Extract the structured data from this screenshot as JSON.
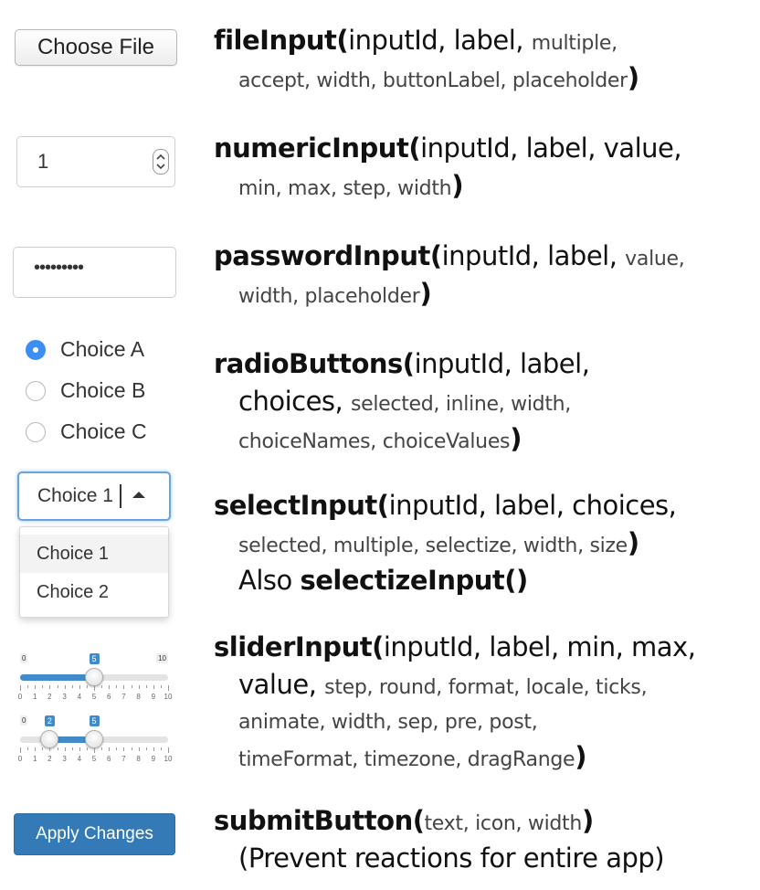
{
  "widgets": {
    "file_button_label": "Choose File",
    "numeric_value": "1",
    "password_mask": "•••••••••",
    "radio": [
      {
        "label": "Choice A",
        "selected": true
      },
      {
        "label": "Choice B",
        "selected": false
      },
      {
        "label": "Choice C",
        "selected": false
      }
    ],
    "select": {
      "value": "Choice 1",
      "options": [
        "Choice 1",
        "Choice 2"
      ],
      "highlighted": "Choice 1"
    },
    "slider_single": {
      "min": "0",
      "max": "10",
      "value": "5",
      "value_fraction": 0.5
    },
    "slider_range": {
      "min": "0",
      "max": "10",
      "from": "2",
      "to": "5",
      "from_fraction": 0.2,
      "to_fraction": 0.5
    },
    "slider_ticks": [
      "0",
      "1",
      "2",
      "3",
      "4",
      "5",
      "6",
      "7",
      "8",
      "9",
      "10"
    ],
    "apply_button_label": "Apply Changes",
    "accent_color": "#428bca"
  },
  "signatures": {
    "fileInput": {
      "name": "fileInput(",
      "line1_args": "inputId, label, ",
      "line1_opt": "multiple,",
      "line2_opt": "accept, width, buttonLabel, placeholder",
      "close": ")"
    },
    "numericInput": {
      "name": "numericInput(",
      "line1_args": "inputId, label, value,",
      "line2_opt": "min, max, step, width",
      "close": ")"
    },
    "passwordInput": {
      "name": "passwordInput(",
      "line1_args": "inputId, label, ",
      "line1_opt": "value,",
      "line2_opt": "width, placeholder",
      "close": ")"
    },
    "radioButtons": {
      "name": "radioButtons(",
      "line1_args": "inputId, label,",
      "line2_args": "choices, ",
      "line2_opt": "selected, inline, width,",
      "line3_opt": "choiceNames, choiceValues",
      "close": ")"
    },
    "selectInput": {
      "name": "selectInput(",
      "line1_args": "inputId, label, choices,",
      "line2_opt": "selected, multiple, selectize, width, size",
      "close": ")",
      "also_prefix": "Also ",
      "also_name": "selectizeInput()"
    },
    "sliderInput": {
      "name": "sliderInput(",
      "line1_args": "inputId, label, min, max,",
      "line2_args": "value, ",
      "line2_opt": "step, round, format, locale, ticks,",
      "line3_opt": "animate, width, sep, pre, post,",
      "line4_opt": "timeFormat, timezone, dragRange",
      "close": ")"
    },
    "submitButton": {
      "name": "submitButton(",
      "line1_opt": "text, icon, width",
      "close": ")",
      "note": "(Prevent reactions for entire app)"
    }
  }
}
